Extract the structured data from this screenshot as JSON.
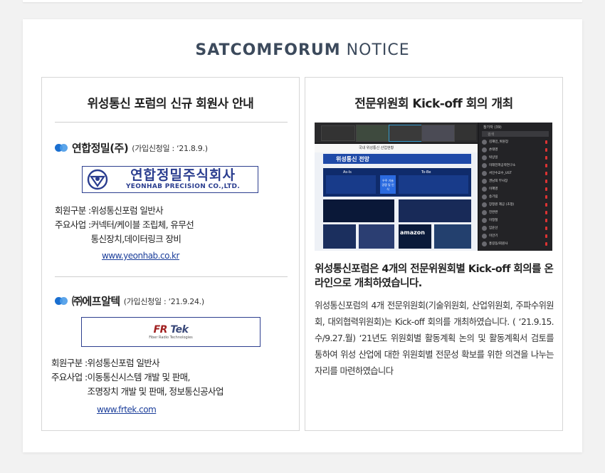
{
  "brand": {
    "bold": "SATCOMFORUM",
    "normal": " NOTICE"
  },
  "left": {
    "title": "위성통신 포럼의 신규 회원사 안내",
    "members": [
      {
        "name": "연합정밀(주)",
        "date": "(가입신청일 :  ‘21.8.9.)",
        "logo_ko": "연합정밀주식회사",
        "logo_en": "YEONHAB PRECISION CO.,LTD.",
        "class_label": "회원구분 : ",
        "class_value": "위성통신포럼 일반사",
        "biz_label": "주요사업 : ",
        "biz_line1": "커넥터/케이블 조립체, 유무선",
        "biz_line2": "통신장치,데이터링크 장비",
        "url": "www.yeonhab.co.kr"
      },
      {
        "name": "㈜에프알텍",
        "date": "(가입신청일 :  ‘21.9.24.)",
        "logo_mark_a": "F",
        "logo_mark_b": "R",
        "logo_mark_c": "Tek",
        "logo_sub": "Fiber Radio Technologies",
        "class_label": "회원구분 : ",
        "class_value": "위성통신포럼 일반사",
        "biz_label": "주요사업 : ",
        "biz_line1": "이동통신시스템 개발 및 판매,",
        "biz_line2": "조명장치 개발 및 판매, 정보통신공사업",
        "url": "www.frtek.com"
      }
    ]
  },
  "right": {
    "title": "전문위원회 Kick-off 회의 개최",
    "headline": "위성통신포럼은 4개의 전문위원회별 Kick-off 회의를 온라인으로 개최하였습니다.",
    "body": "위성통신포럼의 4개 전문위원회(기술위원회, 산업위원회, 주파수위원회, 대외협력위원회)는 Kick-off 회의를 개최하였습니다. ( ‘21.9.15.수/9.27.월) ‘21년도 위원회별 활동계획 논의 및 활동계획서 검토를 통하여 위성 산업에 대한 위원회별 전문성 확보를 위한 의견을 나누는 자리를 마련하였습니다",
    "screenshot": {
      "slide_title": "위성통신 전망",
      "slide_banner": "국내 위성통신 산업현황",
      "col_asis": "As-Is",
      "col_tobe": "To-Be",
      "center_label": "우주 기술 경쟁 및 인식",
      "brand_label": "amazon",
      "panel_header": "참가자 (39)",
      "panel_search": "검색",
      "participants": [
        "김재민_위원장",
        "손태영",
        "박상일",
        "미래전파공학연구소",
        "서인수교수_UST",
        "권남희 부사장",
        "이혜영",
        "송기림",
        "장정원 제공 (초청)",
        "진완완",
        "이정철",
        "임윤선",
        "이만기",
        "홍길동/회원사"
      ]
    }
  }
}
